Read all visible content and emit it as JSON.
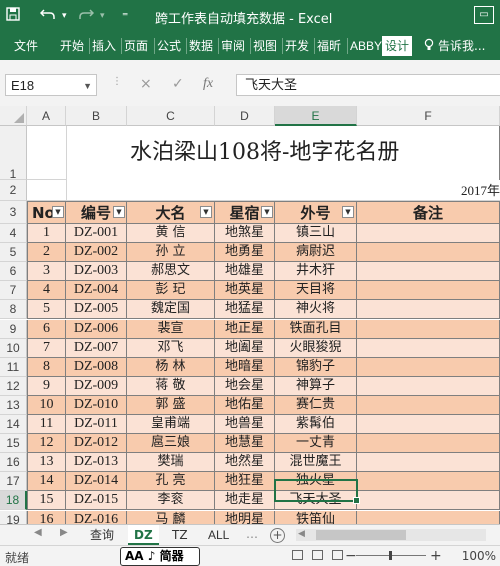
{
  "titlebar": {
    "icons": [
      "save-icon",
      "undo-icon",
      "redo-icon",
      "customize-icon"
    ],
    "title": "跨工作表自动填充数据 - Excel"
  },
  "ribbon": {
    "tabs": [
      "文件",
      "开始",
      "插入",
      "页面",
      "公式",
      "数据",
      "审阅",
      "视图",
      "开发",
      "福昕",
      "ABBY",
      "设计",
      "告诉我..."
    ],
    "active_tab": "设计"
  },
  "formula_bar": {
    "name_box": "E18",
    "cancel_symbol": "×",
    "enter_symbol": "✓",
    "fx_symbol": "fx",
    "content": "飞天大圣"
  },
  "columns": [
    "A",
    "B",
    "C",
    "D",
    "E",
    "F"
  ],
  "selected_column": "E",
  "rows": [
    "1",
    "2",
    "3",
    "4",
    "5",
    "6",
    "7",
    "8",
    "9",
    "10",
    "11",
    "12",
    "13",
    "14",
    "15",
    "16",
    "17",
    "18",
    "19"
  ],
  "selected_row": "18",
  "sheet": {
    "title": "水泊梁山108将-地字花名册",
    "year": "2017年",
    "headers": [
      "No",
      "编号",
      "大名",
      "星宿",
      "外号",
      "备注"
    ],
    "records": [
      [
        "1",
        "DZ-001",
        "黄 信",
        "地煞星",
        "镇三山",
        ""
      ],
      [
        "2",
        "DZ-002",
        "孙 立",
        "地勇星",
        "病尉迟",
        ""
      ],
      [
        "3",
        "DZ-003",
        "郝思文",
        "地雄星",
        "井木犴",
        ""
      ],
      [
        "4",
        "DZ-004",
        "彭 玘",
        "地英星",
        "天目将",
        ""
      ],
      [
        "5",
        "DZ-005",
        "魏定国",
        "地猛星",
        "神火将",
        ""
      ],
      [
        "6",
        "DZ-006",
        "裴宣",
        "地正星",
        "铁面孔目",
        ""
      ],
      [
        "7",
        "DZ-007",
        "邓飞",
        "地阖星",
        "火眼狻猊",
        ""
      ],
      [
        "8",
        "DZ-008",
        "杨 林",
        "地暗星",
        "锦豹子",
        ""
      ],
      [
        "9",
        "DZ-009",
        "蒋 敬",
        "地会星",
        "神算子",
        ""
      ],
      [
        "10",
        "DZ-010",
        "郭 盛",
        "地佑星",
        "赛仁贵",
        ""
      ],
      [
        "11",
        "DZ-011",
        "皇甫端",
        "地兽星",
        "紫髯伯",
        ""
      ],
      [
        "12",
        "DZ-012",
        "扈三娘",
        "地慧星",
        "一丈青",
        ""
      ],
      [
        "13",
        "DZ-013",
        "樊瑞",
        "地然星",
        "混世魔王",
        ""
      ],
      [
        "14",
        "DZ-014",
        "孔 亮",
        "地狂星",
        "独火星",
        ""
      ],
      [
        "15",
        "DZ-015",
        "李衮",
        "地走星",
        "飞天大圣",
        ""
      ],
      [
        "16",
        "DZ-016",
        "马 麟",
        "地明星",
        "铁笛仙",
        ""
      ]
    ]
  },
  "sheet_tabs": {
    "tabs": [
      "查询",
      "DZ",
      "TZ",
      "ALL"
    ],
    "active": "DZ",
    "add_symbol": "+"
  },
  "statusbar": {
    "ready": "就绪",
    "ime": "AA ♪ 简器",
    "zoom_minus": "−",
    "zoom_plus": "+",
    "zoom": "100%",
    "zoom_level": 1.0
  },
  "colors": {
    "excel_green": "#217346",
    "row_pale": "#fbe2d5",
    "row_dark": "#f8cbad"
  }
}
